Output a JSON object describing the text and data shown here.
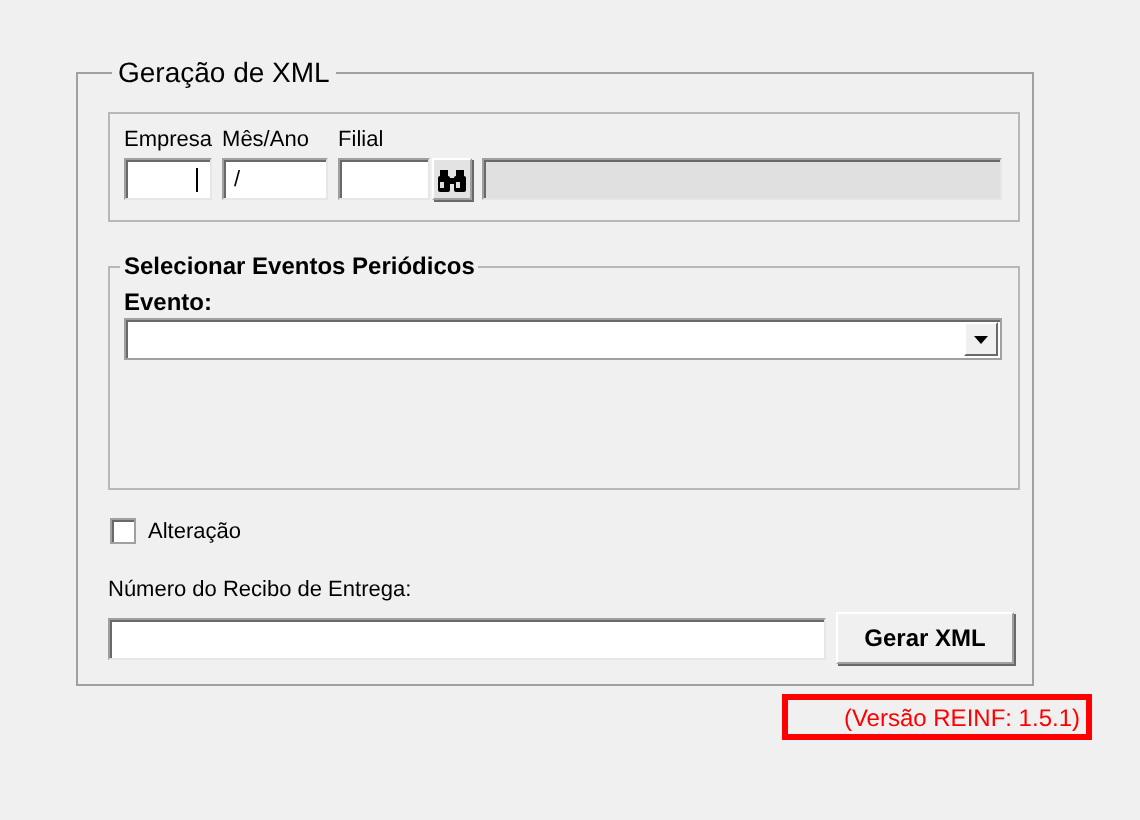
{
  "form": {
    "title": "Geração de XML",
    "header_group": {
      "fields": [
        {
          "label": "Empresa",
          "focused": true
        },
        {
          "label": "Mês/Ano",
          "value": "/",
          "focused": false
        },
        {
          "label": "Filial",
          "focused": false
        }
      ],
      "description": {
        "disabled": true
      }
    },
    "events_group": {
      "title": "Selecionar Eventos Periódicos",
      "label": "Evento:"
    },
    "alteracao": {
      "label": "Alteração",
      "checked": false
    },
    "recibo": {
      "label": "Número do Recibo de Entrega:"
    },
    "button": "Gerar XML"
  },
  "version": "(Versão REINF: 1.5.1)"
}
